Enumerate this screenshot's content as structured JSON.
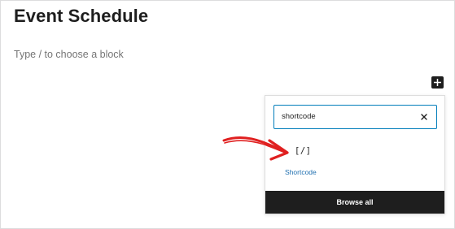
{
  "editor": {
    "post_title": "Event Schedule",
    "block_placeholder": "Type / to choose a block"
  },
  "inserter": {
    "toggle_icon": "plus-icon",
    "search": {
      "value": "shortcode",
      "placeholder": "Search",
      "focus_color": "#007cba"
    },
    "clear_icon": "close-icon",
    "results": [
      {
        "icon": "[/]",
        "icon_name": "shortcode-icon",
        "label": "Shortcode"
      }
    ],
    "browse_all_label": "Browse all"
  },
  "annotation": {
    "type": "hand-drawn arrow",
    "color": "#e02020"
  }
}
